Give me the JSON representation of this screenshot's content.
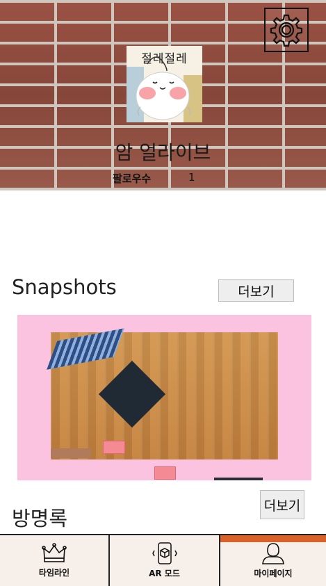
{
  "profile": {
    "avatar_caption": "절레절레",
    "username": "암 얼라이브",
    "followers_label": "팔로우수",
    "followers_count": "1"
  },
  "snapshots": {
    "title": "Snapshots",
    "more_label": "더보기"
  },
  "guestbook": {
    "title": "방명록",
    "more_label": "더보기"
  },
  "nav": {
    "items": [
      {
        "label": "타임라인",
        "icon": "crown-icon"
      },
      {
        "label": "AR 모드",
        "icon": "phone-cube-icon"
      },
      {
        "label": "마이페이지",
        "icon": "person-icon"
      }
    ],
    "active_index": 2,
    "active_color": "#d9622b"
  }
}
